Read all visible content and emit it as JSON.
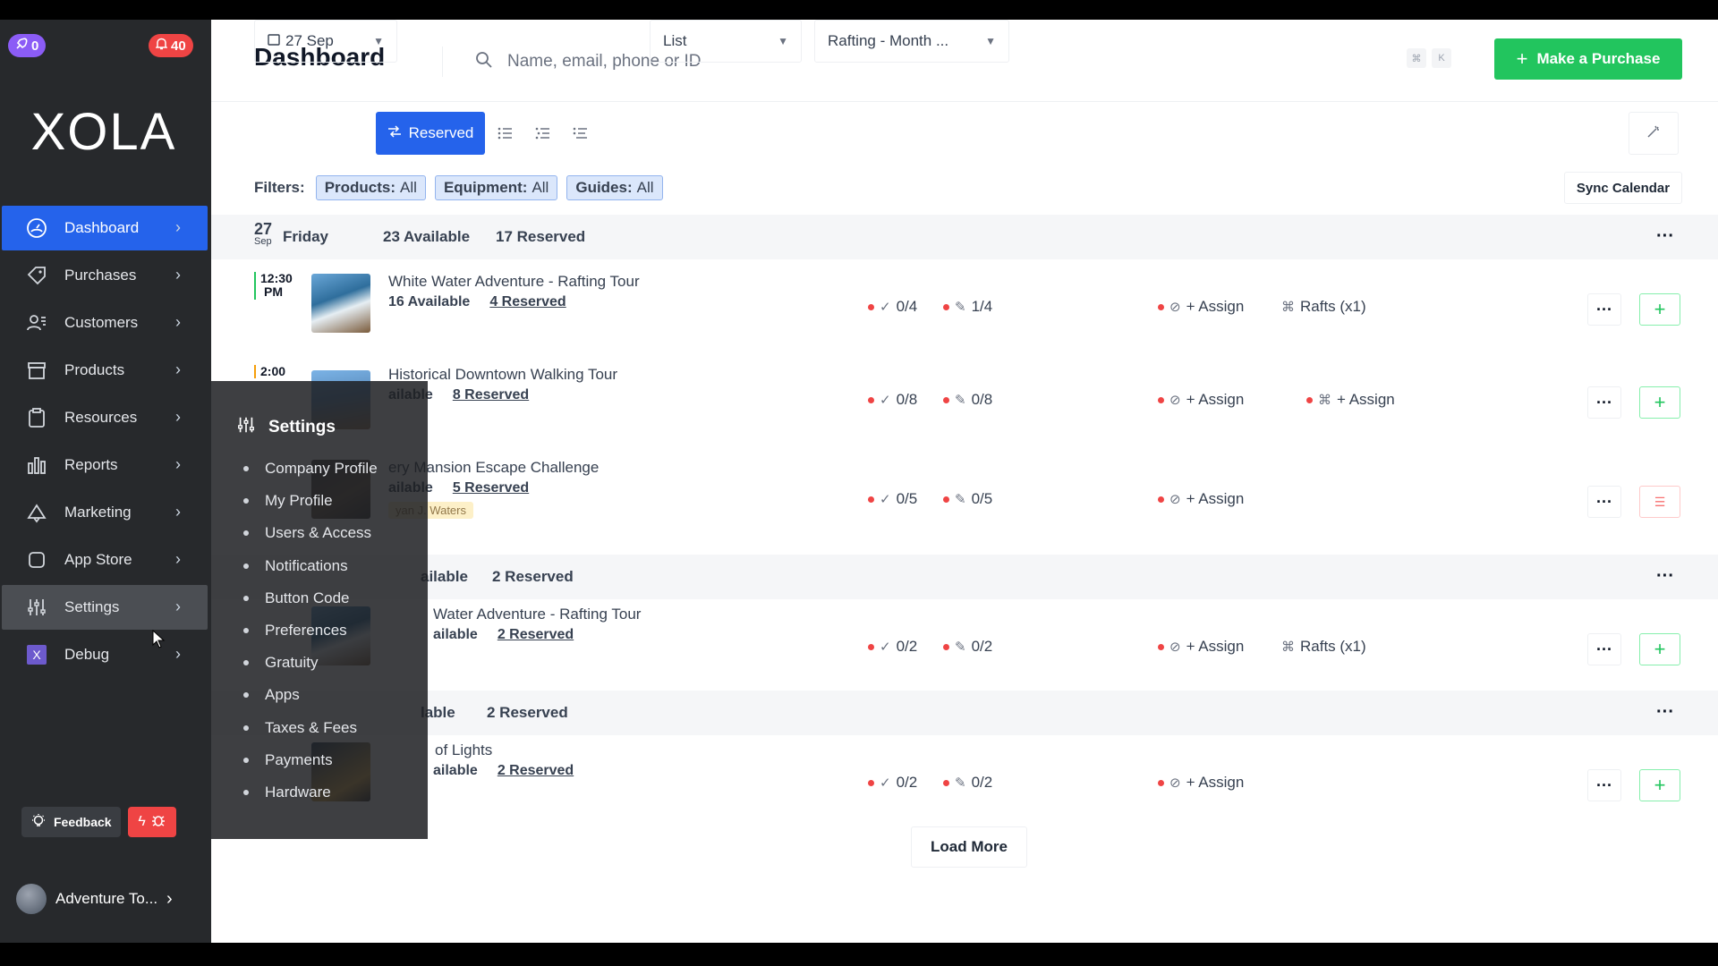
{
  "topbar": {
    "promo_count": "0",
    "alerts_count": "40"
  },
  "brand": {
    "logo": "XOLA"
  },
  "sidebar": {
    "items": [
      {
        "label": "Dashboard",
        "icon": "dashboard-icon"
      },
      {
        "label": "Purchases",
        "icon": "tag-icon"
      },
      {
        "label": "Customers",
        "icon": "users-icon"
      },
      {
        "label": "Products",
        "icon": "box-icon"
      },
      {
        "label": "Resources",
        "icon": "clipboard-icon"
      },
      {
        "label": "Reports",
        "icon": "bar-chart-icon"
      },
      {
        "label": "Marketing",
        "icon": "megaphone-icon"
      },
      {
        "label": "App Store",
        "icon": "app-icon"
      },
      {
        "label": "Settings",
        "icon": "sliders-icon"
      },
      {
        "label": "Debug",
        "icon": "x-icon"
      }
    ],
    "feedback_label": "Feedback",
    "account_label": "Adventure To..."
  },
  "header": {
    "title": "Dashboard",
    "search_placeholder": "Name, email, phone or ID",
    "kbd_1": "⌘",
    "kbd_2": "K",
    "purchase_button": "Make a Purchase"
  },
  "toolbar": {
    "date": "27 Sep",
    "reserved_button": "Reserved",
    "view_select": "List",
    "calendar_select": "Rafting - Month ..."
  },
  "filters": {
    "label": "Filters:",
    "chips": [
      {
        "name": "Products:",
        "value": "All"
      },
      {
        "name": "Equipment:",
        "value": "All"
      },
      {
        "name": "Guides:",
        "value": "All"
      }
    ],
    "sync_button": "Sync Calendar"
  },
  "day": {
    "day_num": "27",
    "month": "Sep",
    "weekday": "Friday",
    "available": "23 Available",
    "reserved": "17 Reserved"
  },
  "slots": [
    {
      "time": "12:30",
      "ampm": "PM",
      "title": "White Water Adventure - Rafting Tour",
      "available": "16 Available",
      "reserved": "4 Reserved",
      "checked": "0/4",
      "signed": "1/4",
      "assign": "+ Assign",
      "equipment": "Rafts (x1)"
    },
    {
      "time": "2:00",
      "ampm": "",
      "title": "Historical Downtown Walking Tour",
      "available": "ailable",
      "reserved": "8 Reserved",
      "checked": "0/8",
      "signed": "0/8",
      "assign": "+ Assign",
      "equipment": "+ Assign"
    },
    {
      "time": "",
      "ampm": "",
      "title": "ery Mansion Escape Challenge",
      "available": "ailable",
      "reserved": "5 Reserved",
      "guide": "yan J. Waters",
      "checked": "0/5",
      "signed": "0/5",
      "assign": "+ Assign"
    }
  ],
  "group2": {
    "available": "ailable",
    "reserved": "2 Reserved"
  },
  "slot4": {
    "title": "Water Adventure - Rafting Tour",
    "available": "ailable",
    "reserved": "2 Reserved",
    "checked": "0/2",
    "signed": "0/2",
    "assign": "+ Assign",
    "equipment": "Rafts (x1)"
  },
  "group3": {
    "available": "lable",
    "reserved": "2 Reserved"
  },
  "slot5": {
    "title": "of Lights",
    "available": "ailable",
    "reserved": "2 Reserved",
    "checked": "0/2",
    "signed": "0/2",
    "assign": "+ Assign"
  },
  "load_more": "Load More",
  "settings_menu": {
    "title": "Settings",
    "items": [
      "Company Profile",
      "My Profile",
      "Users & Access",
      "Notifications",
      "Button Code",
      "Preferences",
      "Gratuity",
      "Apps",
      "Taxes & Fees",
      "Payments",
      "Hardware"
    ]
  },
  "colors": {
    "accent": "#2563eb",
    "success": "#22c55e",
    "danger": "#ef4444",
    "sidebar": "#27292c"
  }
}
